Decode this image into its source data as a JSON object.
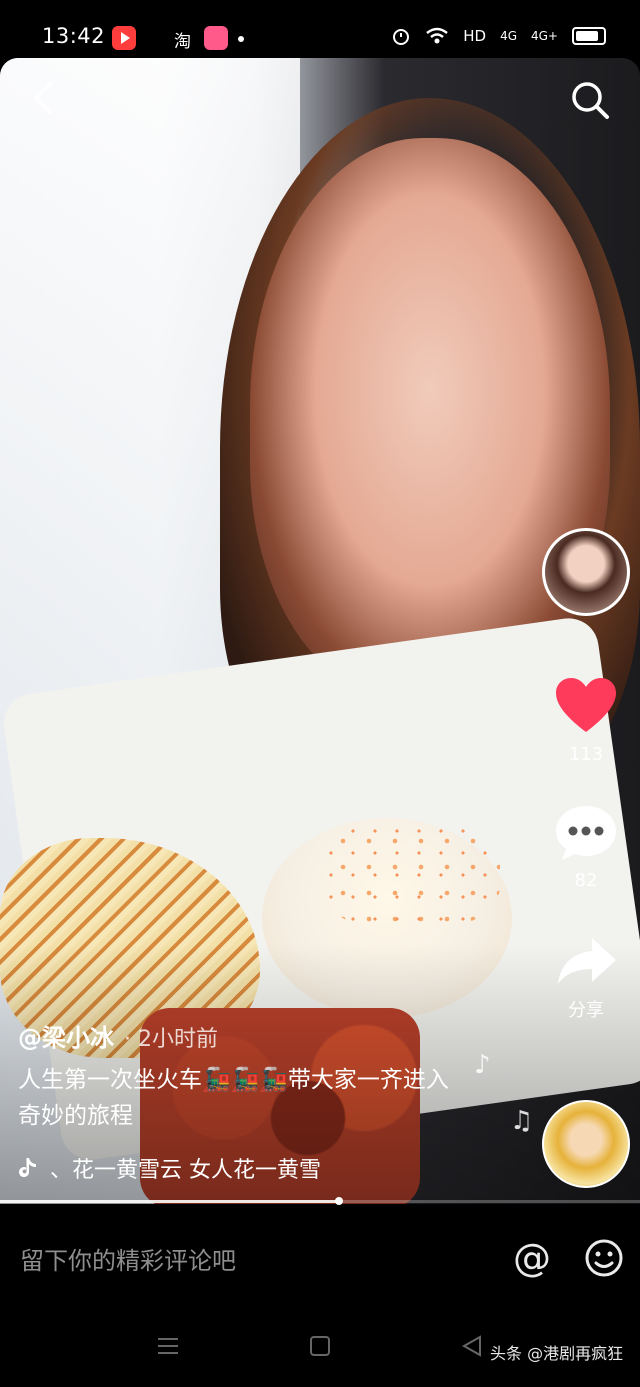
{
  "status_bar": {
    "time": "13:42",
    "app_icons": [
      "video-app-icon",
      "taobao-icon",
      "shop-app-icon"
    ],
    "taobao_label": "淘",
    "network_label": "HD",
    "signal_labels": [
      "4G",
      "4G+"
    ]
  },
  "top_controls": {
    "back_icon": "chevron-left-icon",
    "search_icon": "search-icon"
  },
  "side_actions": {
    "like_count": "113",
    "comment_count": "82",
    "share_label": "分享"
  },
  "post": {
    "author": "@梁小冰",
    "time_ago": "· 2小时前",
    "caption": "人生第一次坐火车🚂🚂🚂带大家一齐进入奇妙的旅程",
    "music_text": "、花一黄雪云   女人花一黄雪",
    "progress_fraction": 0.53
  },
  "comment_bar": {
    "placeholder": "留下你的精彩评论吧",
    "at_symbol": "@"
  },
  "watermark": "头条 @港剧再疯狂",
  "colors": {
    "like": "#ff3b5c",
    "background": "#000000"
  }
}
